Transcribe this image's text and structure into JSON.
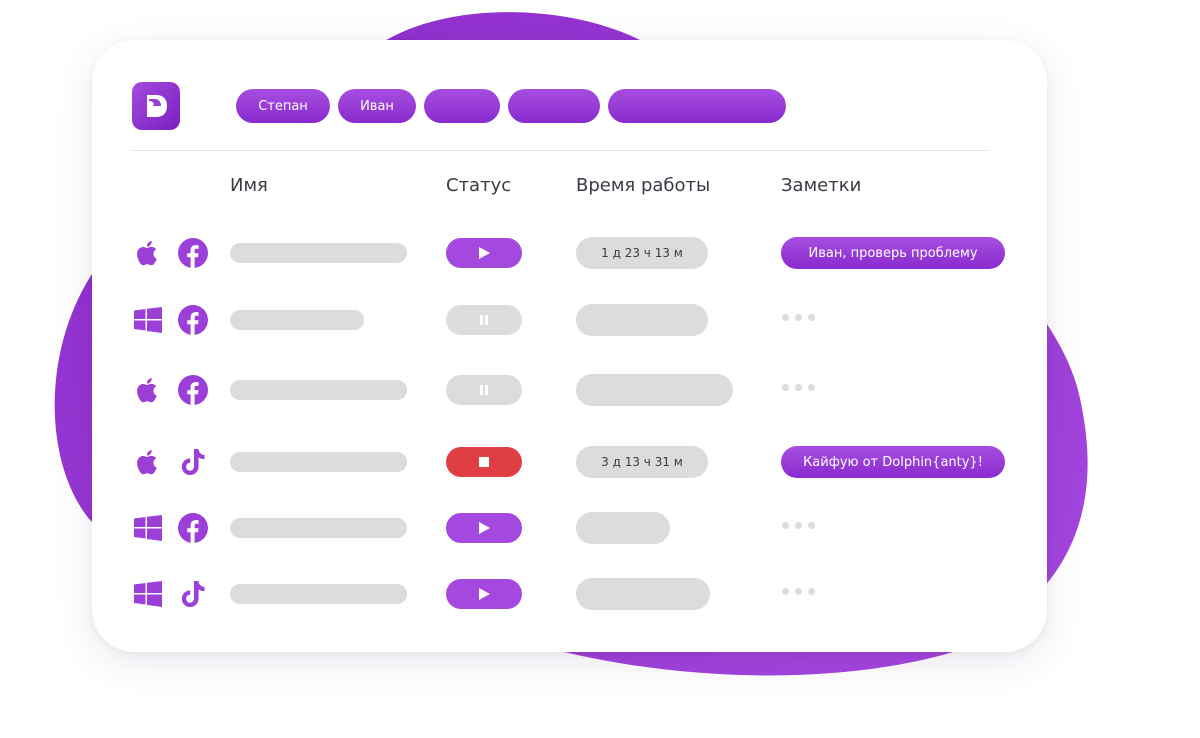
{
  "theme": {
    "accent": "#9b3fd8",
    "stop": "#df3e45",
    "placeholder": "#dcdcdc"
  },
  "header": {
    "logo_icon": "dolphin-logo-icon",
    "tabs": [
      {
        "label": "Степан"
      },
      {
        "label": "Иван"
      },
      {
        "label": ""
      },
      {
        "label": ""
      },
      {
        "label": ""
      }
    ]
  },
  "columns": {
    "name": "Имя",
    "status": "Статус",
    "time": "Время работы",
    "notes": "Заметки"
  },
  "rows": [
    {
      "os": "apple-icon",
      "social": "facebook-icon",
      "status": "play",
      "status_icon": "play-icon",
      "time": "1 д 23 ч 13 м",
      "note": "Иван, проверь проблему"
    },
    {
      "os": "windows-icon",
      "social": "facebook-icon",
      "status": "pause",
      "status_icon": "pause-icon",
      "time": "",
      "note": ""
    },
    {
      "os": "apple-icon",
      "social": "facebook-icon",
      "status": "pause",
      "status_icon": "pause-icon",
      "time": "",
      "note": ""
    },
    {
      "os": "apple-icon",
      "social": "tiktok-icon",
      "status": "stop",
      "status_icon": "stop-icon",
      "time": "3 д 13 ч 31 м",
      "note": "Кайфую от Dolphin{anty}!"
    },
    {
      "os": "windows-icon",
      "social": "facebook-icon",
      "status": "play",
      "status_icon": "play-icon",
      "time": "",
      "note": ""
    },
    {
      "os": "windows-icon",
      "social": "tiktok-icon",
      "status": "play",
      "status_icon": "play-icon",
      "time": "",
      "note": ""
    }
  ]
}
